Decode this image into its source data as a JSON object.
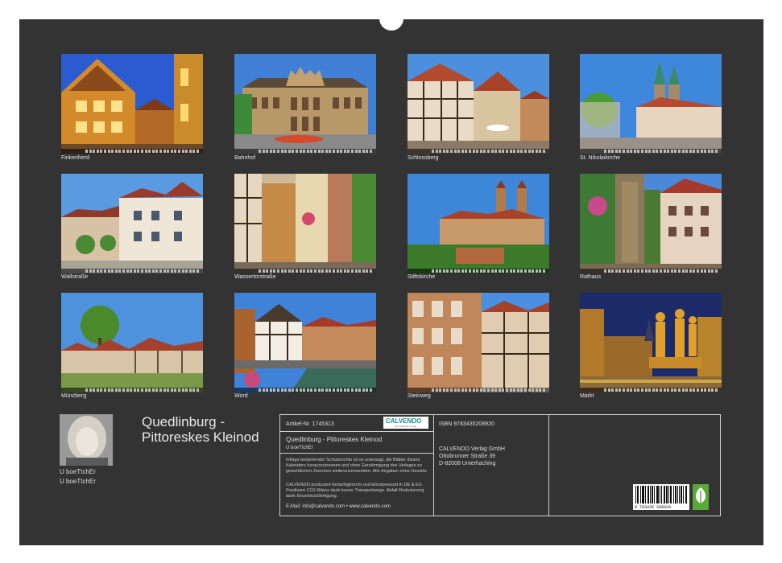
{
  "product": {
    "title": "Quedlinburg - Pittoreskes Kleinod",
    "author": "U boeTtchEr",
    "captions": [
      "Finkenherd",
      "Bahnhof",
      "Schlossberg",
      "St. Nikolaikirche",
      "Wallstraße",
      "Wassertorstraße",
      "Stiftskirche",
      "Rathaus",
      "Münzberg",
      "Word",
      "Steinweg",
      "Markt"
    ]
  },
  "info": {
    "article_label": "Artikel-Nr. 1745313",
    "isbn_label": "ISBN 9783435208920",
    "brand": "CALVENDO",
    "brand_sub": "Der Kalender-Verlag",
    "product_title": "Quedlinburg - Pittoreskes Kleinod",
    "author": "U boeTtchEr",
    "legal_1": "Infolge bestehender Schutzrechte ist es untersagt, die Blätter dieses Kalenders herauszutrennen und ohne Genehmigung des Verlages zu gewerblichen Zwecken weiterzuverwenden. Alle Angaben ohne Gewähr.",
    "legal_2": "CALVENDO produziert bedarfsgerecht und klimabewusst in DE & EU. Positivere CO2-Bilanz dank kurzer Transportwege. Abfall-Reduzierung dank Einzelstückfertigung.",
    "contact": "E-Mail: info@calvendo.com • www.calvendo.com",
    "publisher": "CALVENDO Verlag GmbH",
    "street": "Ottobrunner Straße 39",
    "city": "D-82008 Unterhaching",
    "barcode_digits": "9 783435 208920"
  },
  "colors": {
    "board": "#333333",
    "accent": "#1a8c8f",
    "eco": "#5aa83a"
  }
}
